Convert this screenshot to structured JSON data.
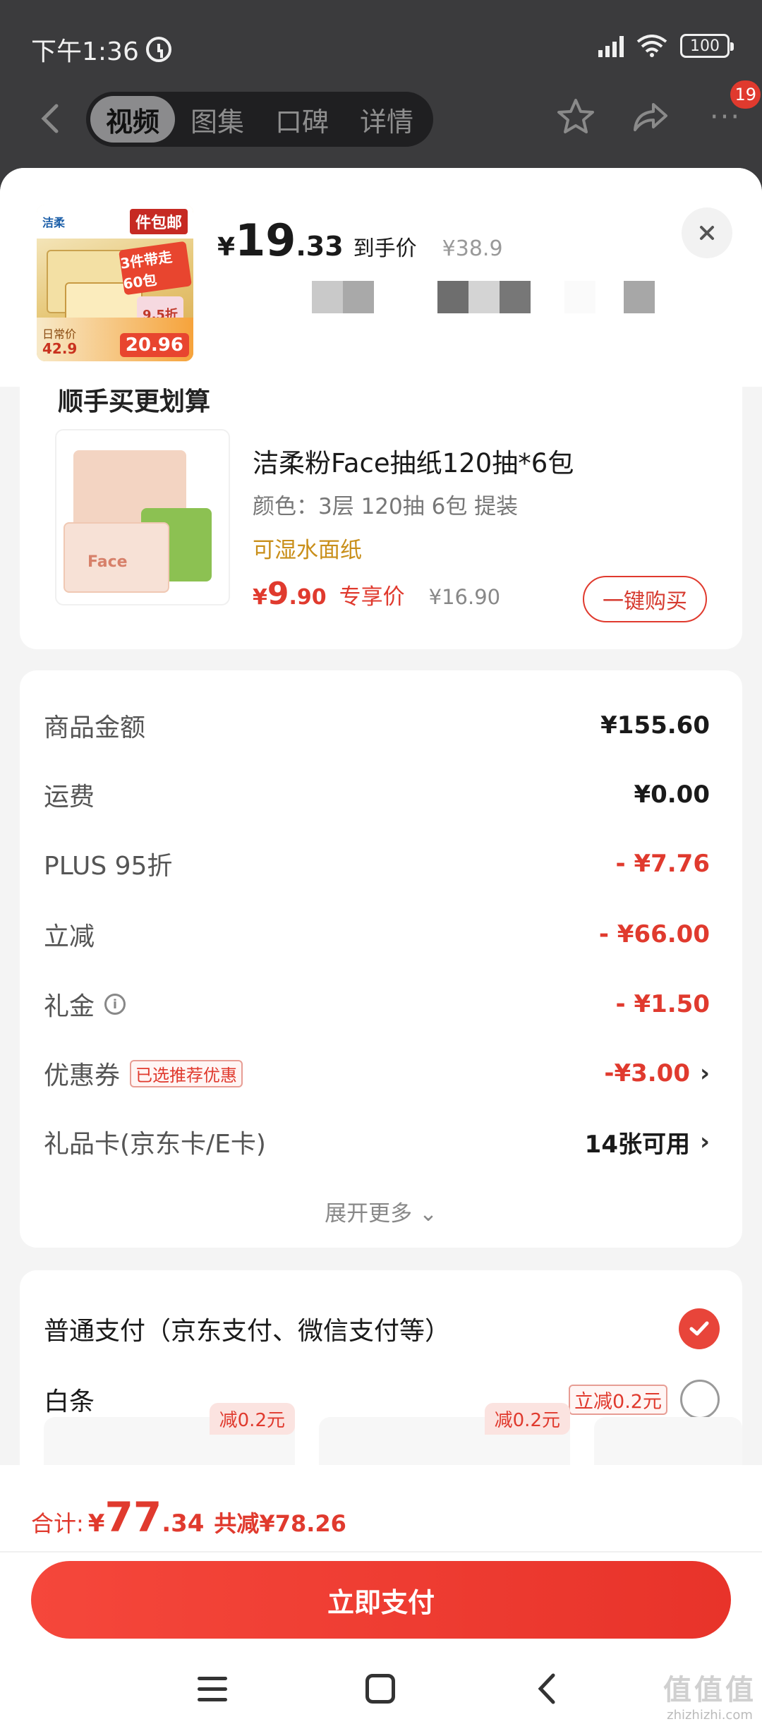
{
  "status_bar": {
    "time": "下午1:36",
    "network": "HD",
    "battery": "100"
  },
  "nav": {
    "tabs": [
      {
        "label": "视频",
        "active": true
      },
      {
        "label": "图集",
        "active": false
      },
      {
        "label": "口碑",
        "active": false
      },
      {
        "label": "详情",
        "active": false
      }
    ],
    "notification_count": "19"
  },
  "header": {
    "price_symbol": "¥",
    "price_int": "19",
    "price_dec": ".33",
    "price_label": "到手价",
    "original_price": "¥38.9",
    "thumb": {
      "brand": "洁柔",
      "tag": "件包邮",
      "promo": "3件带走60包",
      "promo2": "9.5折",
      "daily_label": "日常价",
      "daily_price": "42.9",
      "plus_price": "20.96"
    }
  },
  "recommend": {
    "title": "顺手买更划算",
    "product_name": "洁柔粉Face抽纸120抽*6包",
    "spec": "颜色：3层 120抽 6包 提装",
    "feature": "可湿水面纸",
    "price_symbol": "¥",
    "price_int": "9",
    "price_dec": ".90",
    "price_label": "专享价",
    "original_price": "¥16.90",
    "buy_label": "一键购买",
    "img_text": "Face"
  },
  "summary": {
    "rows": [
      {
        "label": "商品金额",
        "value": "¥155.60"
      },
      {
        "label": "运费",
        "value": "¥0.00"
      },
      {
        "label": "PLUS 95折",
        "value": "- ¥7.76"
      },
      {
        "label": "立减",
        "value": "- ¥66.00"
      },
      {
        "label": "礼金",
        "value": "- ¥1.50"
      },
      {
        "label": "优惠券",
        "badge": "已选推荐优惠",
        "value": "-¥3.00"
      },
      {
        "label": "礼品卡(京东卡/E卡)",
        "value": "14张可用"
      }
    ],
    "expand_label": "展开更多"
  },
  "payment": {
    "normal_label": "普通支付（京东支付、微信支付等）",
    "baitiao_label": "白条",
    "baitiao_badge": "立减0.2元",
    "plan_tags": [
      "减0.2元",
      "减0.2元"
    ]
  },
  "bottom": {
    "total_label": "合计:",
    "total_symbol": "¥",
    "total_int": "77",
    "total_dec": ".34",
    "saved": "共减¥78.26",
    "pay_label": "立即支付"
  },
  "watermark": {
    "top": "值值值",
    "bottom": "zhizhizhi.com"
  },
  "colors": {
    "accent": "#e03a2e",
    "feature": "#c98f1a"
  }
}
